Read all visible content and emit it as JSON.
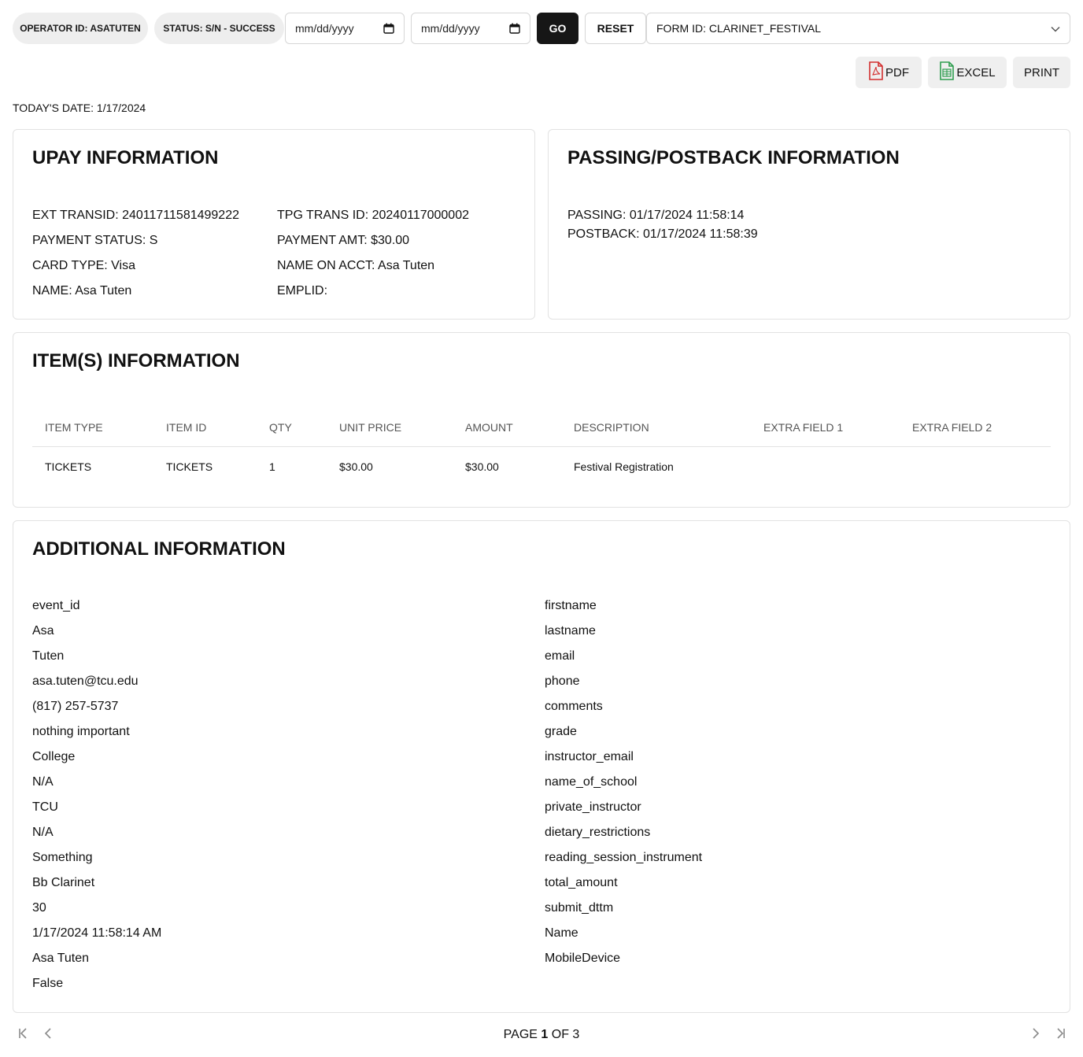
{
  "toolbar": {
    "operator_label": "OPERATOR ID: ASATUTEN",
    "status_label": "STATUS: S/N - SUCCESS",
    "date_from_placeholder": "mm/dd/yyyy",
    "date_to_placeholder": "mm/dd/yyyy",
    "go_label": "GO",
    "reset_label": "RESET",
    "form_select_value": "FORM ID: CLARINET_FESTIVAL"
  },
  "exports": {
    "pdf_label": "PDF",
    "excel_label": "EXCEL",
    "print_label": "PRINT",
    "pdf_color": "#d32f2f",
    "excel_color": "#2e9d4f"
  },
  "today": "TODAY'S DATE: 1/17/2024",
  "upay": {
    "title": "UPAY INFORMATION",
    "ext_transid": "EXT TRANSID: 24011711581499222",
    "tpg_trans_id": "TPG TRANS ID: 20240117000002",
    "payment_status": "PAYMENT STATUS: S",
    "payment_amt": "PAYMENT AMT: $30.00",
    "card_type": "CARD TYPE: Visa",
    "name_on_acct": "NAME ON ACCT: Asa Tuten",
    "name": "NAME: Asa Tuten",
    "emplid": "EMPLID:"
  },
  "passing": {
    "title": "PASSING/POSTBACK INFORMATION",
    "passing": "PASSING: 01/17/2024 11:58:14",
    "postback": "POSTBACK: 01/17/2024 11:58:39"
  },
  "items": {
    "title": "ITEM(S) INFORMATION",
    "columns": [
      "ITEM TYPE",
      "ITEM ID",
      "QTY",
      "UNIT PRICE",
      "AMOUNT",
      "DESCRIPTION",
      "EXTRA FIELD 1",
      "EXTRA FIELD 2"
    ],
    "rows": [
      [
        "TICKETS",
        "TICKETS",
        "1",
        "$30.00",
        "$30.00",
        "Festival Registration",
        "",
        ""
      ]
    ]
  },
  "additional": {
    "title": "ADDITIONAL INFORMATION",
    "left": [
      "event_id",
      "Asa",
      "Tuten",
      "asa.tuten@tcu.edu",
      "(817) 257-5737",
      "nothing important",
      "College",
      "N/A",
      "TCU",
      "N/A",
      "Something",
      "Bb Clarinet",
      "30",
      "1/17/2024 11:58:14 AM",
      "Asa Tuten",
      "False"
    ],
    "right": [
      "firstname",
      "lastname",
      "email",
      "phone",
      "comments",
      "grade",
      "instructor_email",
      "name_of_school",
      "private_instructor",
      "dietary_restrictions",
      "reading_session_instrument",
      "total_amount",
      "submit_dttm",
      "Name",
      "MobileDevice"
    ]
  },
  "pager": {
    "prefix": "PAGE",
    "current": "1",
    "middle": "OF",
    "total": "3"
  }
}
